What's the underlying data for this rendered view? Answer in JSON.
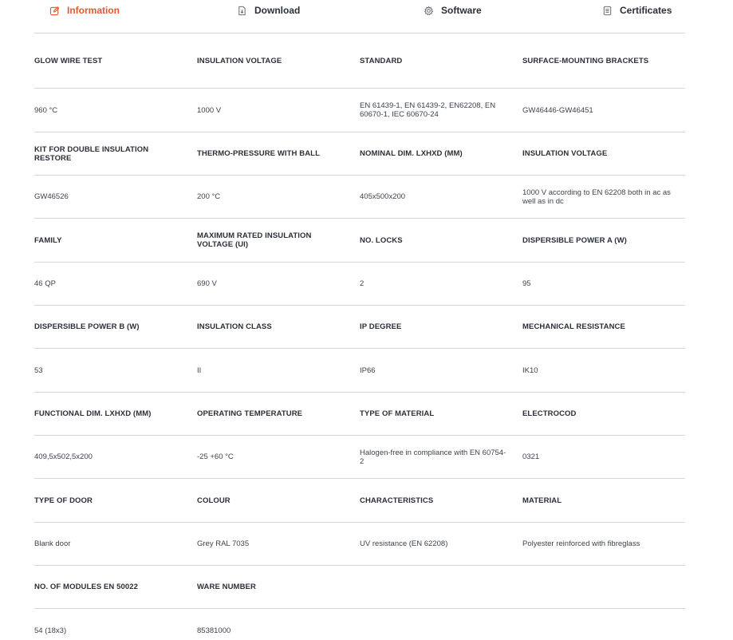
{
  "accent_color": "#e4572e",
  "tabs": [
    {
      "label": "Information",
      "icon": "edit-icon",
      "active": true
    },
    {
      "label": "Download",
      "icon": "download-file-icon",
      "active": false
    },
    {
      "label": "Software",
      "icon": "gear-icon",
      "active": false
    },
    {
      "label": "Certificates",
      "icon": "document-icon",
      "active": false
    }
  ],
  "rows": [
    {
      "labels": [
        "Glow wire test",
        "Insulation voltage",
        "Standard",
        "Surface-mounting brackets"
      ],
      "values": [
        "960 °C",
        "1000 V",
        "EN 61439-1, EN 61439-2, EN62208, EN 60670-1, IEC 60670-24",
        "GW46446-GW46451"
      ]
    },
    {
      "labels": [
        "Kit for double insulation restore",
        "Thermo-pressure with ball",
        "Nominal dim. LxHxD (mm)",
        "Insulation voltage"
      ],
      "values": [
        "GW46526",
        "200 °C",
        "405x500x200",
        "1000 V according to EN 62208 both in ac as well as in dc"
      ]
    },
    {
      "labels": [
        "Family",
        "Maximum rated insulation voltage (Ui)",
        "No. locks",
        "Dispersible power A (W)"
      ],
      "values": [
        "46 QP",
        "690 V",
        "2",
        "95"
      ]
    },
    {
      "labels": [
        "Dispersible power B (W)",
        "Insulation class",
        "IP degree",
        "Mechanical resistance"
      ],
      "values": [
        "53",
        "II",
        "IP66",
        "IK10"
      ]
    },
    {
      "labels": [
        "Functional dim. LxHxD (mm)",
        "Operating temperature",
        "Type of material",
        "Electrocod"
      ],
      "values": [
        "409,5x502,5x200",
        "-25 +60 °C",
        "Halogen-free in compliance with EN 60754-2",
        "0321"
      ]
    },
    {
      "labels": [
        "Type of door",
        "Colour",
        "Characteristics",
        "Material"
      ],
      "values": [
        "Blank door",
        "Grey RAL 7035",
        "UV resistance (EN 62208)",
        "Polyester reinforced with fibreglass"
      ]
    },
    {
      "labels": [
        "No. of modules EN 50022",
        "Ware number",
        "",
        ""
      ],
      "values": [
        "54 (18x3)",
        "85381000",
        "",
        ""
      ]
    }
  ]
}
